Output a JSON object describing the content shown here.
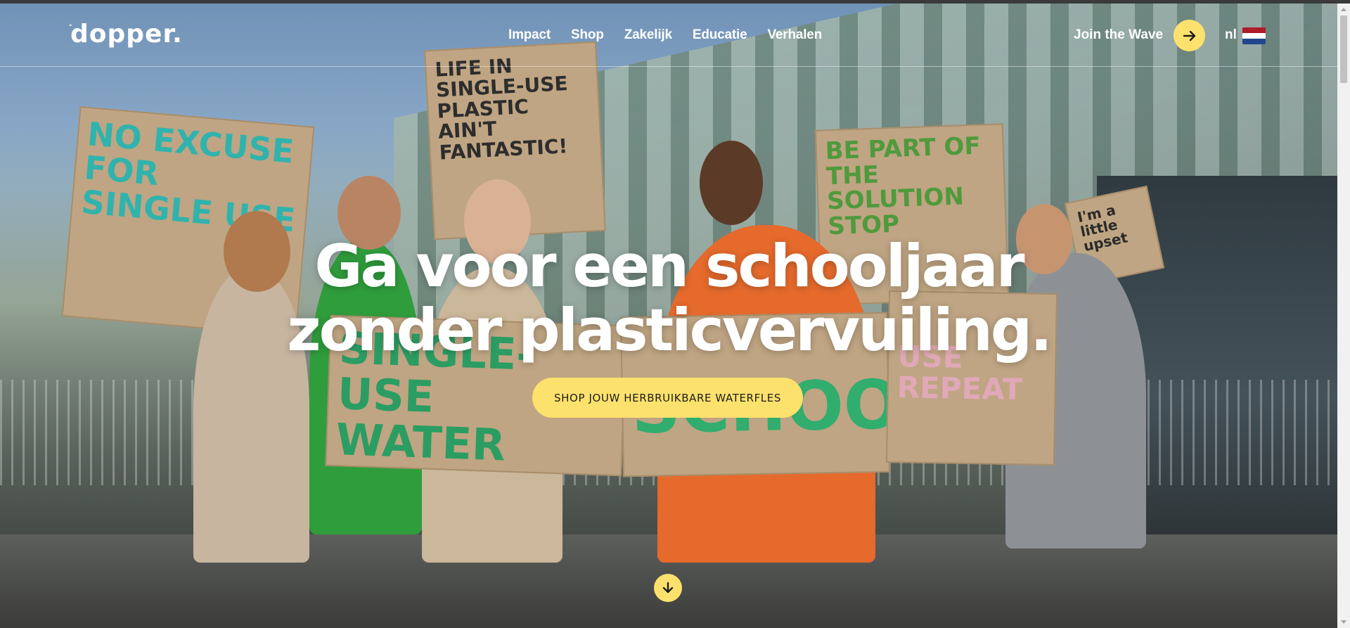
{
  "header": {
    "logo_text": "dopper.",
    "nav": [
      {
        "label": "Impact"
      },
      {
        "label": "Shop"
      },
      {
        "label": "Zakelijk"
      },
      {
        "label": "Educatie"
      },
      {
        "label": "Verhalen"
      }
    ],
    "join_label": "Join the Wave",
    "join_icon": "arrow-right-icon",
    "language": "nl",
    "language_flag_icon": "netherlands-flag-icon"
  },
  "hero": {
    "headline_line1": "Ga voor een schooljaar",
    "headline_line2": "zonder plasticvervuiling.",
    "cta_label": "SHOP JOUW HERBRUIKBARE WATERFLES",
    "scroll_icon": "arrow-down-icon",
    "image_signs": [
      "NO EXCUSE FOR SINGLE USE",
      "LIFE IN SINGLE-USE PLASTIC AIN'T FANTASTIC!",
      "BE PART OF THE SOLUTION STOP",
      "I'm a little upset",
      "SINGLE-USE WATER BOTTLES?",
      "SCHOOL",
      "USE REPEAT"
    ]
  },
  "colors": {
    "accent_yellow": "#fde16d",
    "text_white": "#ffffff",
    "cta_text": "#1d1d1d"
  }
}
